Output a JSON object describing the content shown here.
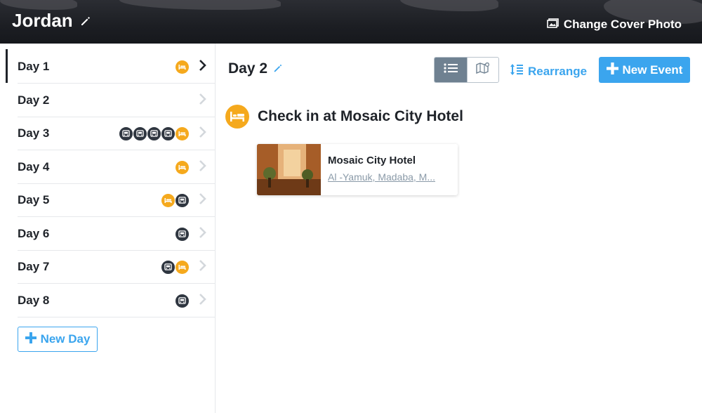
{
  "header": {
    "trip_title": "Jordan",
    "change_cover_label": "Change Cover Photo"
  },
  "sidebar": {
    "days": [
      {
        "label": "Day 1",
        "icons": [
          "bed-icon"
        ],
        "active": true
      },
      {
        "label": "Day 2",
        "icons": [],
        "active": false
      },
      {
        "label": "Day 3",
        "icons": [
          "bus-icon",
          "bus-icon",
          "bus-icon",
          "bus-icon",
          "bed-icon"
        ],
        "active": false
      },
      {
        "label": "Day 4",
        "icons": [
          "bed-icon"
        ],
        "active": false
      },
      {
        "label": "Day 5",
        "icons": [
          "bed-icon",
          "bus-icon"
        ],
        "active": false
      },
      {
        "label": "Day 6",
        "icons": [
          "bus-icon"
        ],
        "active": false
      },
      {
        "label": "Day 7",
        "icons": [
          "bus-icon",
          "bed-icon"
        ],
        "active": false
      },
      {
        "label": "Day 8",
        "icons": [
          "bus-icon"
        ],
        "active": false
      }
    ],
    "new_day_label": "New Day"
  },
  "main": {
    "day_title": "Day 2",
    "rearrange_label": "Rearrange",
    "new_event_label": "New Event",
    "event": {
      "title": "Check in at Mosaic City Hotel",
      "card_name": "Mosaic City Hotel",
      "card_address": "Al -Yamuk, Madaba, M..."
    }
  },
  "colors": {
    "accent": "#3ba5ee",
    "bed": "#f5a91d",
    "bus": "#2f3640"
  }
}
